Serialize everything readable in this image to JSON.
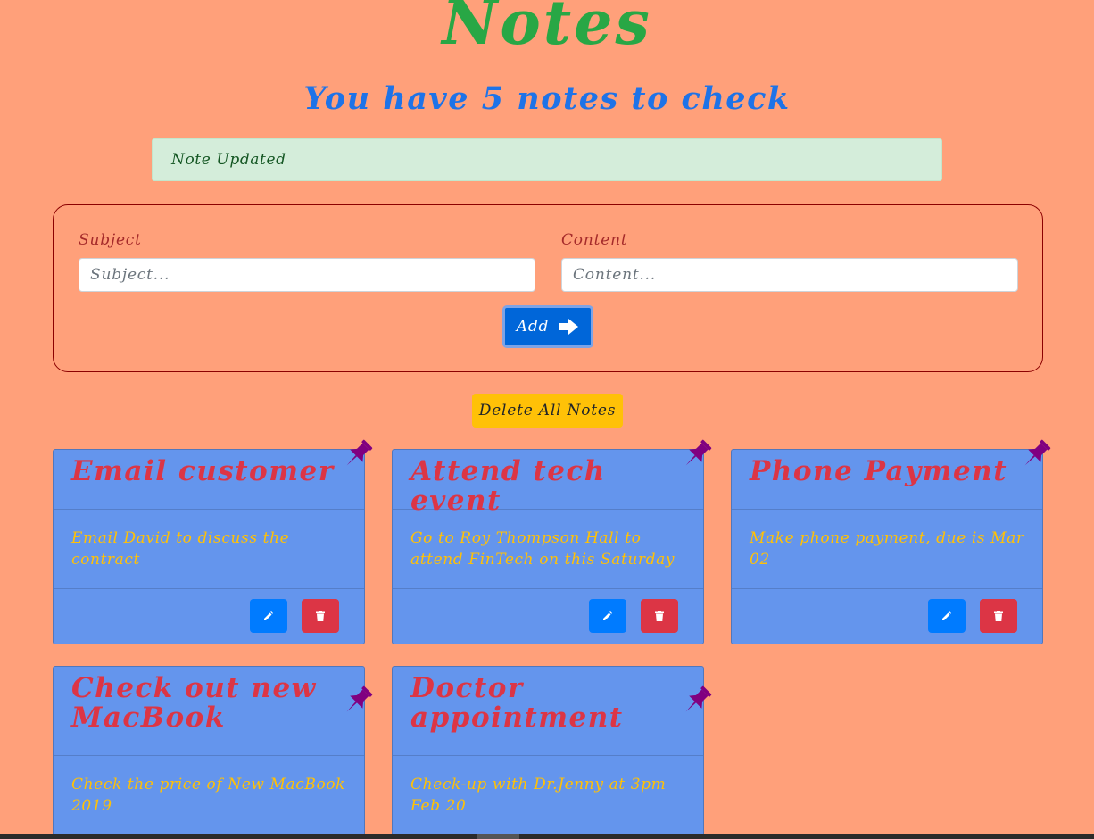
{
  "header": {
    "title": "Notes",
    "count_text": "You have 5 notes to check"
  },
  "alert": {
    "message": "Note Updated"
  },
  "form": {
    "subject_label": "Subject",
    "subject_placeholder": "Subject...",
    "subject_value": "",
    "content_label": "Content",
    "content_placeholder": "Content...",
    "content_value": "",
    "add_label": "Add"
  },
  "actions": {
    "delete_all_label": "Delete All Notes"
  },
  "notes": [
    {
      "title": "Email customer",
      "content": "Email David to discuss the contract"
    },
    {
      "title": "Attend tech event",
      "content": "Go to Roy Thompson Hall to attend FinTech on this Saturday"
    },
    {
      "title": "Phone Payment",
      "content": "Make phone payment, due is Mar 02"
    },
    {
      "title": "Check out new MacBook",
      "content": "Check the price of New MacBook 2019"
    },
    {
      "title": "Doctor appointment",
      "content": "Check-up with Dr.Jenny at 3pm Feb 20"
    }
  ],
  "icons": {
    "add": "arrow-right-icon",
    "edit": "pencil-icon",
    "delete": "trash-icon",
    "pin": "pushpin-icon"
  },
  "colors": {
    "background": "#FFA07A",
    "title": "#28A745",
    "subtitle": "#1E73E8",
    "card": "#6495ED",
    "card_title": "#DC3545",
    "card_text": "#FFC107",
    "pin": "#800080"
  }
}
